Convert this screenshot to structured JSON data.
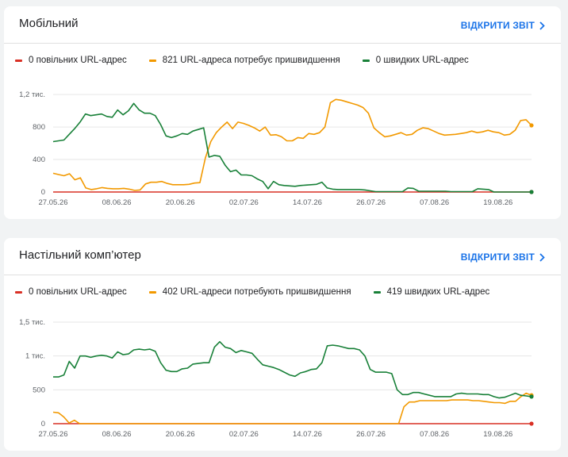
{
  "colors": {
    "slow": "#d93025",
    "improve": "#f29900",
    "fast": "#188038",
    "link": "#1a73e8"
  },
  "cards": [
    {
      "title": "Мобільний",
      "link_label": "ВІДКРИТИ ЗВІТ",
      "legend": [
        "0 повільних URL-адрес",
        "821 URL-адреса потребує пришвидшення",
        "0 швидких URL-адрес"
      ]
    },
    {
      "title": "Настільний комп’ютер",
      "link_label": "ВІДКРИТИ ЗВІТ",
      "legend": [
        "0 повільних URL-адрес",
        "402 URL-адреси потребують пришвидшення",
        "419 швидких URL-адрес"
      ]
    }
  ],
  "chart_data": [
    {
      "type": "line",
      "title": "",
      "x_tick_labels": [
        "27.05.26",
        "08.06.26",
        "20.06.26",
        "02.07.26",
        "14.07.26",
        "26.07.26",
        "07.08.26",
        "19.08.26"
      ],
      "y_ticks": [
        0,
        400,
        800,
        1200
      ],
      "y_tick_labels": [
        "0",
        "400",
        "800",
        "1,2 тис."
      ],
      "ylim": [
        0,
        1250
      ],
      "grid": true,
      "legend_position": "top",
      "series": [
        {
          "name": "0 повільних URL-адрес",
          "color": "#d93025",
          "values": [
            0,
            0,
            0,
            0,
            0,
            0,
            0,
            0,
            0,
            0,
            0,
            0,
            0,
            0,
            0,
            0,
            0,
            0,
            0,
            0,
            0,
            0,
            0,
            0,
            0,
            0,
            0,
            0,
            0,
            0,
            0,
            0,
            0,
            0,
            0,
            0,
            0,
            0,
            0,
            0,
            0,
            0,
            0,
            0,
            0,
            0,
            0,
            0,
            0,
            0,
            0,
            0,
            0,
            0,
            0,
            0,
            0,
            0,
            0,
            0,
            0,
            0,
            0,
            0,
            0,
            0,
            0,
            0,
            0,
            0,
            0,
            0,
            0,
            0,
            0,
            0,
            0,
            0,
            0,
            0,
            0,
            0,
            0,
            0,
            0,
            0,
            0,
            0,
            0,
            0
          ]
        },
        {
          "name": "821 URL-адреса потребує пришвидшення",
          "color": "#f29900",
          "values": [
            230,
            215,
            200,
            225,
            150,
            175,
            50,
            30,
            40,
            55,
            45,
            40,
            40,
            45,
            35,
            20,
            25,
            100,
            120,
            120,
            130,
            105,
            90,
            90,
            90,
            95,
            110,
            115,
            420,
            620,
            730,
            800,
            860,
            780,
            860,
            845,
            820,
            790,
            750,
            800,
            700,
            705,
            680,
            630,
            630,
            670,
            660,
            720,
            710,
            730,
            800,
            1100,
            1140,
            1130,
            1110,
            1090,
            1070,
            1040,
            970,
            790,
            730,
            680,
            690,
            710,
            730,
            700,
            710,
            760,
            790,
            780,
            750,
            720,
            700,
            705,
            710,
            720,
            730,
            750,
            730,
            740,
            760,
            740,
            730,
            700,
            710,
            760,
            880,
            890,
            820
          ]
        },
        {
          "name": "0 швидких URL-адрес",
          "color": "#188038",
          "values": [
            620,
            630,
            640,
            710,
            780,
            860,
            960,
            940,
            950,
            960,
            930,
            920,
            1010,
            950,
            1000,
            1090,
            1010,
            970,
            970,
            940,
            830,
            690,
            670,
            690,
            720,
            710,
            750,
            770,
            790,
            430,
            450,
            440,
            330,
            250,
            270,
            210,
            210,
            200,
            160,
            130,
            40,
            130,
            90,
            80,
            75,
            70,
            80,
            85,
            90,
            95,
            120,
            50,
            35,
            30,
            30,
            30,
            30,
            30,
            25,
            15,
            5,
            5,
            5,
            5,
            5,
            5,
            50,
            45,
            10,
            10,
            10,
            10,
            10,
            10,
            5,
            5,
            5,
            5,
            5,
            40,
            35,
            30,
            0,
            0,
            0,
            0,
            0,
            0,
            0,
            0
          ]
        }
      ]
    },
    {
      "type": "line",
      "title": "",
      "x_tick_labels": [
        "27.05.26",
        "08.06.26",
        "20.06.26",
        "02.07.26",
        "14.07.26",
        "26.07.26",
        "07.08.26",
        "19.08.26"
      ],
      "y_ticks": [
        0,
        500,
        1000,
        1500
      ],
      "y_tick_labels": [
        "0",
        "500",
        "1 тис.",
        "1,5 тис."
      ],
      "ylim": [
        0,
        1500
      ],
      "grid": true,
      "legend_position": "top",
      "series": [
        {
          "name": "0 повільних URL-адрес",
          "color": "#d93025",
          "values": [
            0,
            0,
            0,
            0,
            0,
            0,
            0,
            0,
            0,
            0,
            0,
            0,
            0,
            0,
            0,
            0,
            0,
            0,
            0,
            0,
            0,
            0,
            0,
            0,
            0,
            0,
            0,
            0,
            0,
            0,
            0,
            0,
            0,
            0,
            0,
            0,
            0,
            0,
            0,
            0,
            0,
            0,
            0,
            0,
            0,
            0,
            0,
            0,
            0,
            0,
            0,
            0,
            0,
            0,
            0,
            0,
            0,
            0,
            0,
            0,
            0,
            0,
            0,
            0,
            0,
            0,
            0,
            0,
            0,
            0,
            0,
            0,
            0,
            0,
            0,
            0,
            0,
            0,
            0,
            0,
            0,
            0,
            0,
            0,
            0,
            0,
            0,
            0,
            0,
            0
          ]
        },
        {
          "name": "402 URL-адреси потребують пришвидшення",
          "color": "#f29900",
          "values": [
            170,
            160,
            100,
            10,
            50,
            0,
            0,
            0,
            0,
            0,
            0,
            0,
            0,
            0,
            0,
            0,
            0,
            0,
            0,
            0,
            0,
            0,
            0,
            0,
            0,
            0,
            0,
            0,
            0,
            0,
            0,
            0,
            0,
            0,
            0,
            0,
            0,
            0,
            0,
            0,
            0,
            0,
            0,
            0,
            0,
            0,
            0,
            0,
            0,
            0,
            0,
            0,
            0,
            0,
            0,
            0,
            0,
            0,
            0,
            0,
            0,
            0,
            0,
            0,
            0,
            0,
            250,
            320,
            320,
            340,
            340,
            340,
            340,
            340,
            340,
            350,
            350,
            350,
            350,
            340,
            340,
            330,
            320,
            310,
            310,
            300,
            330,
            330,
            400,
            450,
            420
          ]
        },
        {
          "name": "419 швидких URL-адрес",
          "color": "#188038",
          "values": [
            690,
            690,
            720,
            920,
            820,
            1000,
            1000,
            980,
            1000,
            1010,
            1000,
            970,
            1060,
            1020,
            1030,
            1090,
            1100,
            1090,
            1100,
            1070,
            900,
            790,
            770,
            770,
            810,
            820,
            880,
            890,
            900,
            900,
            1130,
            1210,
            1130,
            1110,
            1050,
            1080,
            1060,
            1040,
            950,
            870,
            850,
            830,
            800,
            760,
            720,
            700,
            750,
            770,
            800,
            810,
            900,
            1150,
            1160,
            1150,
            1130,
            1110,
            1110,
            1090,
            1000,
            800,
            760,
            760,
            760,
            740,
            500,
            430,
            430,
            460,
            460,
            440,
            420,
            400,
            400,
            400,
            400,
            440,
            450,
            440,
            440,
            440,
            430,
            430,
            400,
            380,
            390,
            420,
            450,
            420,
            410,
            400
          ]
        }
      ]
    }
  ]
}
